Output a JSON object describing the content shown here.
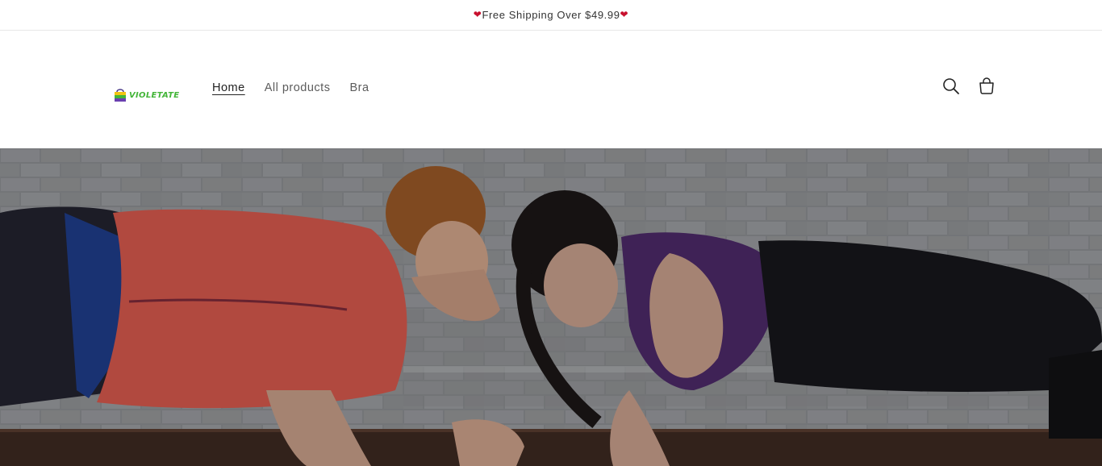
{
  "announcement": {
    "text": "Free Shipping Over $49.99",
    "left_icon": "heart-icon",
    "right_icon": "heart-icon"
  },
  "header": {
    "logo_text": "VIOLETATE",
    "nav": {
      "home": "Home",
      "all_products": "All products",
      "bra": "Bra"
    },
    "icons": {
      "search": "search-icon",
      "cart": "cart-icon"
    }
  },
  "hero": {
    "image": "two-women-planking-photo"
  },
  "colors": {
    "logo_green": "#43b538",
    "heart_red": "#c8102e",
    "text": "#222222",
    "nav_muted": "#5c5c5c"
  }
}
